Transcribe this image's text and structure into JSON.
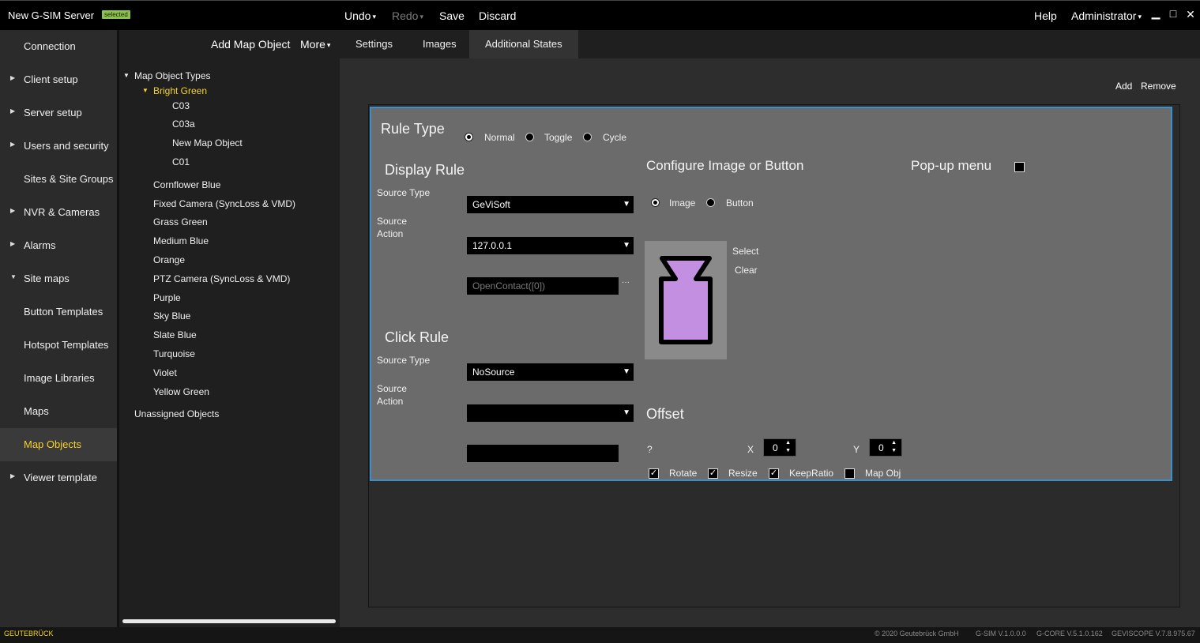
{
  "titlebar": {
    "app_title": "New G-SIM Server",
    "badge": "selected",
    "undo": "Undo",
    "redo": "Redo",
    "save": "Save",
    "discard": "Discard",
    "help": "Help",
    "user": "Administrator",
    "caret": "▾",
    "minimize": "▁",
    "maximize": "□",
    "close": "✕"
  },
  "nav": {
    "items": [
      {
        "label": "Connection",
        "arrow": ""
      },
      {
        "label": "Client setup",
        "arrow": "▶"
      },
      {
        "label": "Server setup",
        "arrow": "▶"
      },
      {
        "label": "Users and security",
        "arrow": "▶"
      },
      {
        "label": "Sites & Site Groups",
        "arrow": ""
      },
      {
        "label": "NVR & Cameras",
        "arrow": "▶"
      },
      {
        "label": "Alarms",
        "arrow": "▶"
      },
      {
        "label": "Site maps",
        "arrow": "▼"
      },
      {
        "label": "Button Templates",
        "arrow": ""
      },
      {
        "label": "Hotspot Templates",
        "arrow": ""
      },
      {
        "label": "Image Libraries",
        "arrow": ""
      },
      {
        "label": "Maps",
        "arrow": ""
      },
      {
        "label": "Map Objects",
        "arrow": ""
      },
      {
        "label": "Viewer template",
        "arrow": "▶"
      }
    ]
  },
  "tree": {
    "add_button": "Add Map Object",
    "more_button": "More",
    "root": "Map Object Types",
    "selected_group": "Bright Green",
    "children": [
      "C03",
      "C03a",
      "New Map Object",
      "C01"
    ],
    "groups": [
      "Cornflower Blue",
      "Fixed Camera (SyncLoss & VMD)",
      "Grass Green",
      "Medium Blue",
      "Orange",
      "PTZ Camera (SyncLoss & VMD)",
      "Purple",
      "Sky Blue",
      "Slate Blue",
      "Turquoise",
      "Violet",
      "Yellow Green"
    ],
    "unassigned": "Unassigned Objects",
    "arrow_down": "▼"
  },
  "tabs": [
    "Settings",
    "Images",
    "Additional States"
  ],
  "actions": {
    "add": "Add",
    "remove": "Remove"
  },
  "state": {
    "rule_type_label": "Rule Type",
    "rule_options": [
      "Normal",
      "Toggle",
      "Cycle"
    ],
    "display_rule": {
      "title": "Display Rule",
      "source_type_label": "Source Type",
      "source_type_value": "GeViSoft",
      "source_action_label_1": "Source",
      "source_action_label_2": "Action",
      "source_action_value": "127.0.0.1",
      "action_text": "OpenContact([0])",
      "ellipsis": "···"
    },
    "click_rule": {
      "title": "Click Rule",
      "source_type_label": "Source Type",
      "source_type_value": "NoSource",
      "source_action_label_1": "Source",
      "source_action_label_2": "Action",
      "source_action_value": "",
      "action_text": ""
    },
    "configure": {
      "title": "Configure Image or Button",
      "options": [
        "Image",
        "Button"
      ],
      "select": "Select",
      "clear": "Clear",
      "image_color": "#c38fe0"
    },
    "popup_label": "Pop-up menu",
    "offset": {
      "title": "Offset",
      "help": "?",
      "x_label": "X",
      "x_value": "0",
      "y_label": "Y",
      "y_value": "0",
      "spin_up": "▲",
      "spin_down": "▼"
    },
    "checks": [
      {
        "label": "Rotate",
        "checked": true
      },
      {
        "label": "Resize",
        "checked": true
      },
      {
        "label": "KeepRatio",
        "checked": true
      },
      {
        "label": "Map Obj",
        "checked": false
      }
    ],
    "check_mark": "✓",
    "dd_caret": "▼"
  },
  "statusbar": {
    "brand": "GEUTEBRÜCK",
    "copyright": "© 2020 Geutebrück GmbH",
    "gsim": "G-SIM V.1.0.0.0",
    "gcore": "G-CORE V.5.1.0.162",
    "geviscope": "GEVISCOPE V.7.8.975.67"
  },
  "colors": {
    "accent_yellow": "#f5d22c",
    "selection_border": "#3d8ec9",
    "badge_green": "#8bc34a"
  }
}
